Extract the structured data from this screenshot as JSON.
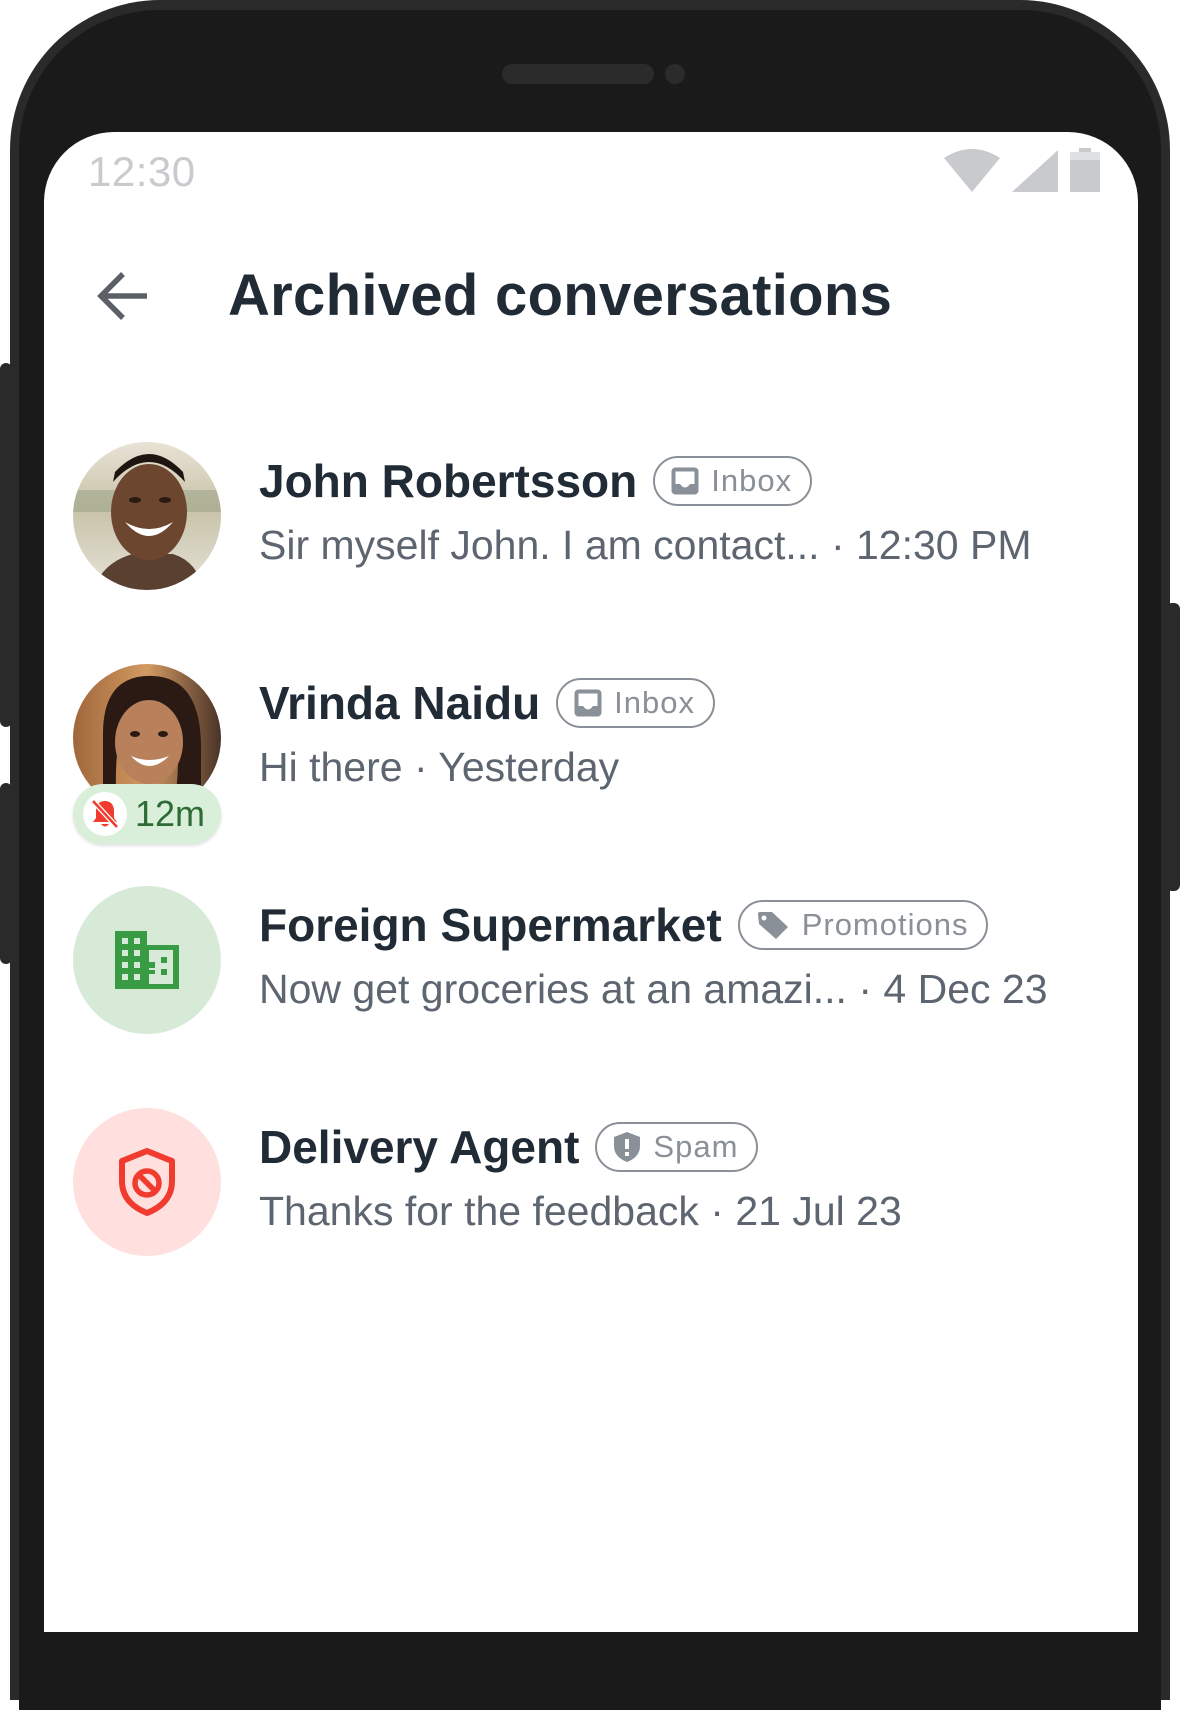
{
  "status_bar": {
    "time": "12:30",
    "icons": [
      "wifi-icon",
      "cellular-signal-icon",
      "battery-icon"
    ]
  },
  "app_bar": {
    "back_icon": "arrow-left-icon",
    "title": "Archived conversations"
  },
  "conversations": [
    {
      "name": "John Robertsson",
      "avatar": "photo",
      "tag": {
        "label": "Inbox",
        "icon": "inbox-icon"
      },
      "preview": "Sir myself John. I am contact...",
      "separator": "·",
      "time": "12:30 PM"
    },
    {
      "name": "Vrinda Naidu",
      "avatar": "photo",
      "tag": {
        "label": "Inbox",
        "icon": "inbox-icon"
      },
      "preview": "Hi there",
      "separator": "·",
      "time": "Yesterday",
      "snooze": {
        "icon": "bell-off-icon",
        "label": "12m"
      }
    },
    {
      "name": "Foreign Supermarket",
      "avatar": "building-icon",
      "avatar_bg": "#d7ead8",
      "avatar_fg": "#3a9b45",
      "tag": {
        "label": "Promotions",
        "icon": "tag-icon"
      },
      "preview": "Now get groceries at an amazi...",
      "separator": "·",
      "time": "4 Dec 23"
    },
    {
      "name": "Delivery Agent",
      "avatar": "shield-block-icon",
      "avatar_bg": "#ffe0de",
      "avatar_fg": "#f03b2e",
      "tag": {
        "label": "Spam",
        "icon": "shield-alert-icon"
      },
      "preview": "Thanks for the feedback",
      "separator": "·",
      "time": "21 Jul 23"
    }
  ],
  "colors": {
    "title": "#212b36",
    "secondary_text": "#5d6670",
    "tag_outline": "#8a9097",
    "snooze_bg": "#d9efd9",
    "snooze_text": "#2e6b35",
    "bell_off": "#f03b2e"
  }
}
